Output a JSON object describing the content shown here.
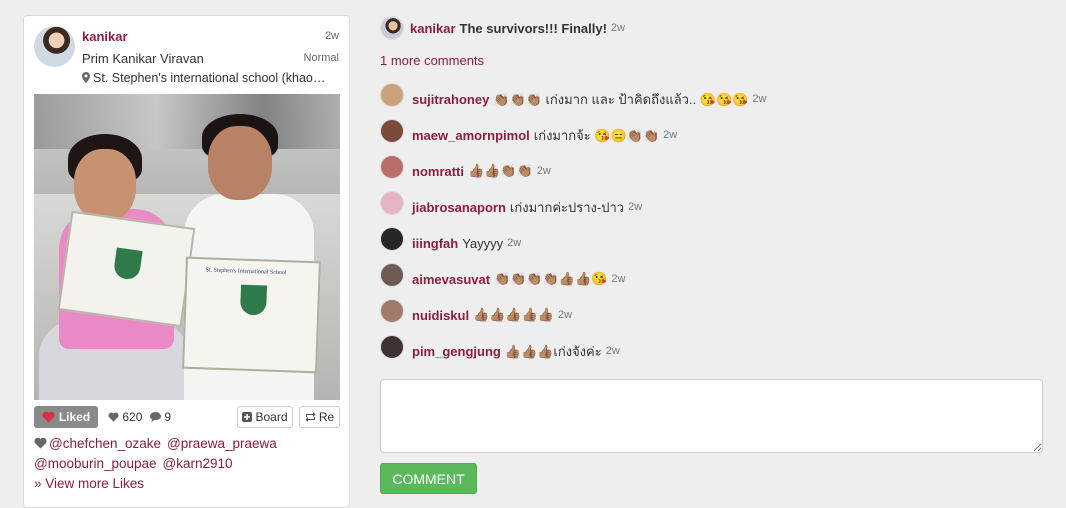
{
  "post": {
    "username": "kanikar",
    "time": "2w",
    "full_name": "Prim Kanikar Viravan",
    "filter": "Normal",
    "location": "St. Stephen's international school (khao…",
    "photo_alt": "St. Stephen's International School",
    "liked_label": "Liked",
    "like_count": "620",
    "comment_count": "9",
    "board_label": "Board",
    "repost_label": "Re",
    "likers": [
      "@chefchen_ozake",
      "@praewa_praewa",
      "@mooburin_poupae",
      "@karn2910"
    ],
    "view_more_likes": "» View more Likes"
  },
  "caption": {
    "username": "kanikar",
    "text": "The survivors!!! Finally!",
    "time": "2w"
  },
  "more_comments_label": "1 more comments",
  "comments": [
    {
      "username": "sujitrahoney",
      "text": "👏🏽👏🏽👏🏽 เก่งมาก และ ป้าคิดถึงแล้ว.. 😘😘😘",
      "time": "2w",
      "avatar_color": "#c9a17d"
    },
    {
      "username": "maew_amornpimol",
      "text": "เก่งมากจ้ะ 😘😑👏🏽👏🏽",
      "time": "2w",
      "avatar_color": "#7a4a3a"
    },
    {
      "username": "nomratti",
      "text": "👍🏽👍🏽👏🏽👏🏽",
      "time": "2w",
      "avatar_color": "#b96e6c"
    },
    {
      "username": "jiabrosanaporn",
      "text": "เก่งมากค่ะปราง-ปาว",
      "time": "2w",
      "avatar_color": "#e6b4c4"
    },
    {
      "username": "iiingfah",
      "text": "Yayyyy",
      "time": "2w",
      "avatar_color": "#2a2625"
    },
    {
      "username": "aimevasuvat",
      "text": "👏🏽👏🏽👏🏽👏🏽👍🏽👍🏽😘",
      "time": "2w",
      "avatar_color": "#6e5a52"
    },
    {
      "username": "nuidiskul",
      "text": "👍🏽👍🏽👍🏽👍🏽👍🏽",
      "time": "2w",
      "avatar_color": "#a07a6a"
    },
    {
      "username": "pim_gengjung",
      "text": "👍🏽👍🏽👍🏽เก่งจังค่ะ",
      "time": "2w",
      "avatar_color": "#3e3330"
    }
  ],
  "reply": {
    "value": "",
    "placeholder": "",
    "submit_label": "COMMENT"
  },
  "colors": {
    "link": "#8a1f3c",
    "submit": "#5cb85c",
    "liked_bg": "#8a8a8a",
    "heart": "#d7304a"
  }
}
